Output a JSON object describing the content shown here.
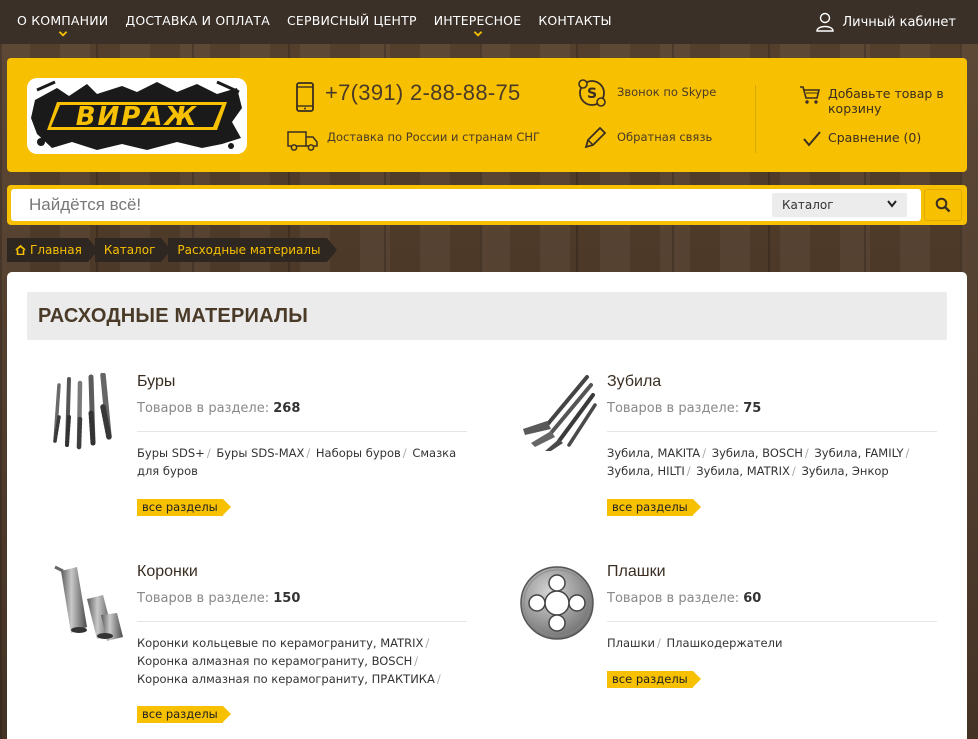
{
  "topnav": {
    "items": [
      "О КОМПАНИИ",
      "ДОСТАВКА И ОПЛАТА",
      "СЕРВИСНЫЙ ЦЕНТР",
      "ИНТЕРЕСНОЕ",
      "КОНТАКТЫ"
    ],
    "account": "Личный кабинет"
  },
  "header": {
    "logo_text": "ВИРАЖ",
    "phone": "+7(391) 2-88-88-75",
    "delivery": "Доставка по России и странам СНГ",
    "skype": "Звонок по Skype",
    "feedback": "Обратная связь",
    "cart": "Добавьте товар в корзину",
    "compare": "Сравнение (0)"
  },
  "search": {
    "placeholder": "Найдётся всё!",
    "category": "Каталог"
  },
  "breadcrumb": [
    "Главная",
    "Каталог",
    "Расходные материалы"
  ],
  "page": {
    "title": "РАСХОДНЫЕ МАТЕРИАЛЫ",
    "count_label": "Товаров в разделе:",
    "all_label": "все разделы"
  },
  "categories": [
    {
      "name": "Буры",
      "count": "268",
      "subs": [
        "Буры SDS+",
        "Буры SDS-MAX",
        "Наборы буров",
        "Смазка для буров"
      ]
    },
    {
      "name": "Зубила",
      "count": "75",
      "subs": [
        "Зубила, MAKITA",
        "Зубила, BOSCH",
        "Зубила, FAMILY",
        "Зубила, HILTI",
        "Зубила, MATRIX",
        "Зубила, Энкор"
      ]
    },
    {
      "name": "Коронки",
      "count": "150",
      "subs": [
        "Коронки кольцевые по керамограниту, MATRIX",
        "Коронка алмазная по керамограниту, BOSCH",
        "Коронка алмазная по керамограниту, ПРАКТИКА"
      ]
    },
    {
      "name": "Плашки",
      "count": "60",
      "subs": [
        "Плашки",
        "Плашкодержатели"
      ]
    }
  ]
}
